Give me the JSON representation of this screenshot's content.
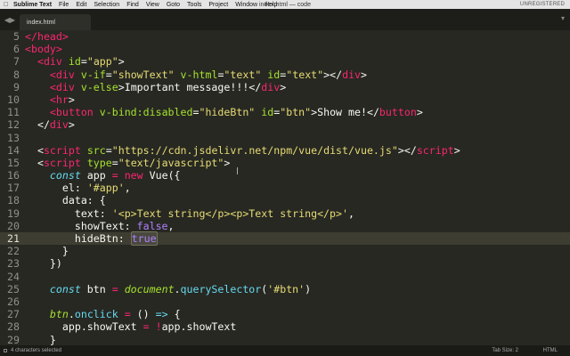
{
  "menubar": {
    "app": "Sublime Text",
    "items": [
      "File",
      "Edit",
      "Selection",
      "Find",
      "View",
      "Goto",
      "Tools",
      "Project",
      "Window",
      "Help"
    ],
    "window_title": "index.html — code",
    "unregistered": "UNREGISTERED"
  },
  "tab": {
    "label": "index.html"
  },
  "editor": {
    "current_line": 21,
    "lines": [
      {
        "n": "5",
        "t": [
          [
            "</",
            "tg"
          ],
          [
            "head",
            "tg"
          ],
          [
            ">",
            "tg"
          ]
        ]
      },
      {
        "n": "6",
        "t": [
          [
            "<",
            "tg"
          ],
          [
            "body",
            "tg"
          ],
          [
            ">",
            "tg"
          ]
        ]
      },
      {
        "n": "7",
        "t": [
          [
            "  ",
            ""
          ],
          [
            "<",
            "tg"
          ],
          [
            "div",
            "tg"
          ],
          [
            " ",
            ""
          ],
          [
            "id",
            "at"
          ],
          [
            "=",
            ""
          ],
          [
            "\"app\"",
            "st"
          ],
          [
            ">",
            ""
          ]
        ]
      },
      {
        "n": "8",
        "t": [
          [
            "    ",
            ""
          ],
          [
            "<",
            "tg"
          ],
          [
            "div",
            "tg"
          ],
          [
            " ",
            ""
          ],
          [
            "v-if",
            "at"
          ],
          [
            "=",
            ""
          ],
          [
            "\"showText\"",
            "st"
          ],
          [
            " ",
            ""
          ],
          [
            "v-html",
            "at"
          ],
          [
            "=",
            ""
          ],
          [
            "\"text\"",
            "st"
          ],
          [
            " ",
            ""
          ],
          [
            "id",
            "at"
          ],
          [
            "=",
            ""
          ],
          [
            "\"text\"",
            "st"
          ],
          [
            "></",
            ""
          ],
          [
            "div",
            "tg"
          ],
          [
            ">",
            ""
          ]
        ]
      },
      {
        "n": "9",
        "t": [
          [
            "    ",
            ""
          ],
          [
            "<",
            "tg"
          ],
          [
            "div",
            "tg"
          ],
          [
            " ",
            ""
          ],
          [
            "v-else",
            "at"
          ],
          [
            ">Important message!!!</",
            ""
          ],
          [
            "div",
            "tg"
          ],
          [
            ">",
            ""
          ]
        ]
      },
      {
        "n": "10",
        "t": [
          [
            "    ",
            ""
          ],
          [
            "<",
            "tg"
          ],
          [
            "hr",
            "tg"
          ],
          [
            ">",
            ""
          ]
        ]
      },
      {
        "n": "11",
        "t": [
          [
            "    ",
            ""
          ],
          [
            "<",
            "tg"
          ],
          [
            "button",
            "tg"
          ],
          [
            " ",
            ""
          ],
          [
            "v-bind:disabled",
            "at"
          ],
          [
            "=",
            ""
          ],
          [
            "\"hideBtn\"",
            "st"
          ],
          [
            " ",
            ""
          ],
          [
            "id",
            "at"
          ],
          [
            "=",
            ""
          ],
          [
            "\"btn\"",
            "st"
          ],
          [
            ">Show me!</",
            ""
          ],
          [
            "button",
            "tg"
          ],
          [
            ">",
            ""
          ]
        ]
      },
      {
        "n": "12",
        "t": [
          [
            "  </",
            ""
          ],
          [
            "div",
            "tg"
          ],
          [
            ">",
            ""
          ]
        ]
      },
      {
        "n": "13",
        "t": []
      },
      {
        "n": "14",
        "t": [
          [
            "  <",
            ""
          ],
          [
            "script",
            "tg"
          ],
          [
            " ",
            ""
          ],
          [
            "src",
            "at"
          ],
          [
            "=",
            ""
          ],
          [
            "\"https://cdn.jsdelivr.net/npm/vue/dist/vue.js\"",
            "st"
          ],
          [
            "></",
            ""
          ],
          [
            "script",
            "tg"
          ],
          [
            ">",
            ""
          ]
        ]
      },
      {
        "n": "15",
        "t": [
          [
            "  <",
            ""
          ],
          [
            "script",
            "tg"
          ],
          [
            " ",
            ""
          ],
          [
            "type",
            "at"
          ],
          [
            "=",
            ""
          ],
          [
            "\"text/javascript\"",
            "st"
          ],
          [
            ">",
            ""
          ]
        ]
      },
      {
        "n": "16",
        "t": [
          [
            "    ",
            ""
          ],
          [
            "const",
            "kw"
          ],
          [
            " app ",
            ""
          ],
          [
            "=",
            "op"
          ],
          [
            " ",
            ""
          ],
          [
            "new",
            "op"
          ],
          [
            " Vue({",
            ""
          ]
        ]
      },
      {
        "n": "17",
        "t": [
          [
            "      el: ",
            ""
          ],
          [
            "'#app'",
            "st"
          ],
          [
            ",",
            ""
          ]
        ]
      },
      {
        "n": "18",
        "t": [
          [
            "      data: {",
            ""
          ]
        ]
      },
      {
        "n": "19",
        "t": [
          [
            "        text: ",
            ""
          ],
          [
            "'<p>Text string</p><p>Text string</p>'",
            "st"
          ],
          [
            ",",
            ""
          ]
        ]
      },
      {
        "n": "20",
        "t": [
          [
            "        showText: ",
            ""
          ],
          [
            "false",
            "bo"
          ],
          [
            ",",
            ""
          ]
        ]
      },
      {
        "n": "21",
        "t": [
          [
            "        hideBtn: ",
            ""
          ],
          [
            "true",
            "bs"
          ]
        ]
      },
      {
        "n": "22",
        "t": [
          [
            "      }",
            ""
          ]
        ]
      },
      {
        "n": "23",
        "t": [
          [
            "    })",
            ""
          ]
        ]
      },
      {
        "n": "24",
        "t": []
      },
      {
        "n": "25",
        "t": [
          [
            "    ",
            ""
          ],
          [
            "const",
            "kw"
          ],
          [
            " btn ",
            ""
          ],
          [
            "=",
            "op"
          ],
          [
            " ",
            ""
          ],
          [
            "document",
            "bi"
          ],
          [
            ".",
            ""
          ],
          [
            "querySelector",
            "fn"
          ],
          [
            "(",
            ""
          ],
          [
            "'#btn'",
            "st"
          ],
          [
            ")",
            ""
          ]
        ]
      },
      {
        "n": "26",
        "t": []
      },
      {
        "n": "27",
        "t": [
          [
            "    ",
            ""
          ],
          [
            "btn",
            "bi"
          ],
          [
            ".",
            ""
          ],
          [
            "onclick",
            "fn"
          ],
          [
            " ",
            ""
          ],
          [
            "=",
            "op"
          ],
          [
            " () ",
            ""
          ],
          [
            "=>",
            "kw"
          ],
          [
            " {",
            ""
          ]
        ]
      },
      {
        "n": "28",
        "t": [
          [
            "      app.showText ",
            ""
          ],
          [
            "=",
            "op"
          ],
          [
            " ",
            ""
          ],
          [
            "!",
            "op"
          ],
          [
            "app.showText",
            ""
          ]
        ]
      },
      {
        "n": "29",
        "t": [
          [
            "    }",
            ""
          ]
        ]
      }
    ]
  },
  "status": {
    "selection": "4 characters selected",
    "tab_size": "Tab Size: 2",
    "syntax": "HTML"
  },
  "colors": {
    "tg": "#f92672",
    "at": "#a6e22e",
    "st": "#e6db74",
    "kw": "#66d9ef",
    "op": "#f92672",
    "fn": "#66d9ef",
    "bi": "#a6e22e",
    "bo": "#ae81ff",
    "bs": "#ae81ff"
  }
}
